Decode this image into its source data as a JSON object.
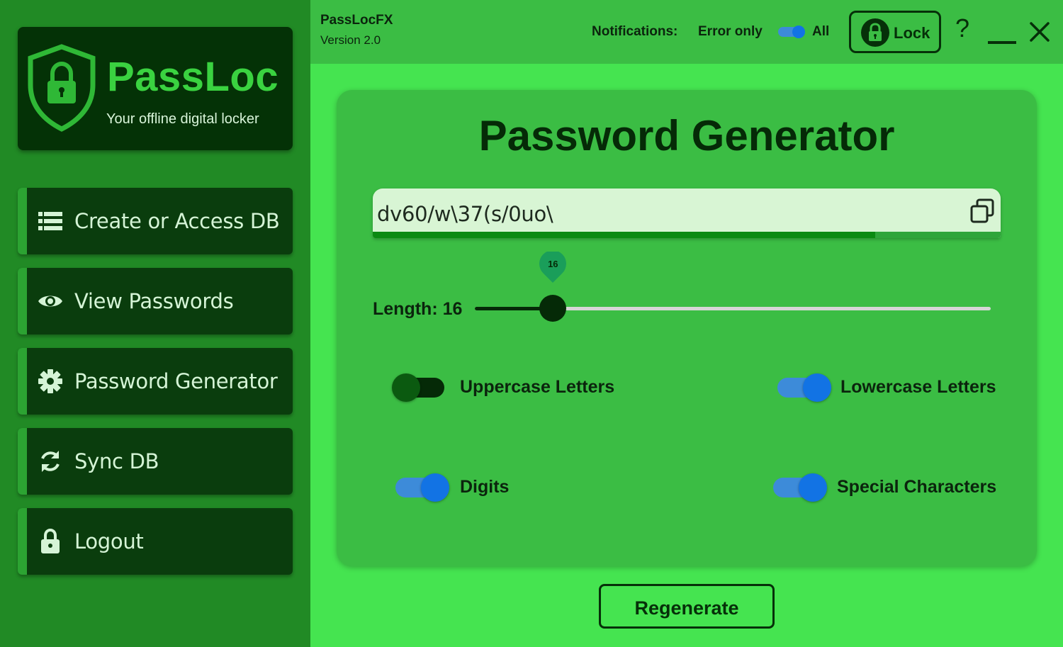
{
  "app": {
    "name": "PassLoc",
    "tagline": "Your offline digital locker",
    "window_title": "PassLocFX",
    "version": "Version 2.0"
  },
  "sidebar": {
    "items": [
      {
        "label": "Create or Access DB",
        "icon": "list-icon"
      },
      {
        "label": "View Passwords",
        "icon": "eye-icon"
      },
      {
        "label": "Password Generator",
        "icon": "gear-icon"
      },
      {
        "label": "Sync DB",
        "icon": "sync-icon"
      },
      {
        "label": "Logout",
        "icon": "lock-icon"
      }
    ]
  },
  "topbar": {
    "notifications_label": "Notifications:",
    "notifications_error": "Error only",
    "notifications_all": "All",
    "notifications_mode": "All",
    "lock_label": "Lock",
    "help_glyph": "?"
  },
  "generator": {
    "title": "Password Generator",
    "password": "dv60/w\\37(s/0uo\\",
    "strength_fraction": 0.8,
    "length_label": "Length: 16",
    "length_value": 16,
    "length_min": 1,
    "length_max": 100,
    "options": {
      "uppercase": {
        "label": "Uppercase Letters",
        "enabled": false
      },
      "lowercase": {
        "label": "Lowercase Letters",
        "enabled": true
      },
      "digits": {
        "label": "Digits",
        "enabled": true
      },
      "special": {
        "label": "Special Characters",
        "enabled": true
      }
    },
    "regenerate_label": "Regenerate"
  },
  "colors": {
    "sidebar_bg": "#218a25",
    "card_bg": "#0a3d0d",
    "accent_green": "#3ad240",
    "toggle_on": "#1273e4",
    "dark_text": "#052a07"
  }
}
